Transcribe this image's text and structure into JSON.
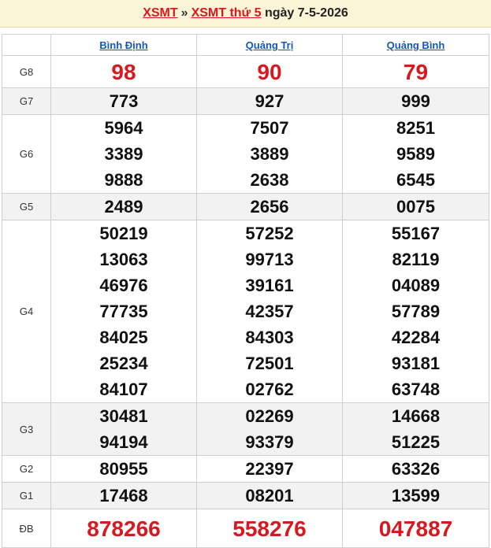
{
  "header": {
    "link1": "XSMT",
    "sep": "»",
    "link2": "XSMT thứ 5",
    "date_text": "ngày 7-5-2026"
  },
  "columns": [
    "Bình Định",
    "Quảng Trị",
    "Quảng Bình"
  ],
  "rows": [
    {
      "label": "G8",
      "values": [
        [
          "98"
        ],
        [
          "90"
        ],
        [
          "79"
        ]
      ]
    },
    {
      "label": "G7",
      "values": [
        [
          "773"
        ],
        [
          "927"
        ],
        [
          "999"
        ]
      ]
    },
    {
      "label": "G6",
      "values": [
        [
          "5964",
          "3389",
          "9888"
        ],
        [
          "7507",
          "3889",
          "2638"
        ],
        [
          "8251",
          "9589",
          "6545"
        ]
      ]
    },
    {
      "label": "G5",
      "values": [
        [
          "2489"
        ],
        [
          "2656"
        ],
        [
          "0075"
        ]
      ]
    },
    {
      "label": "G4",
      "values": [
        [
          "50219",
          "13063",
          "46976",
          "77735",
          "84025",
          "25234",
          "84107"
        ],
        [
          "57252",
          "99713",
          "39161",
          "42357",
          "84303",
          "72501",
          "02762"
        ],
        [
          "55167",
          "82119",
          "04089",
          "57789",
          "42284",
          "93181",
          "63748"
        ]
      ]
    },
    {
      "label": "G3",
      "values": [
        [
          "30481",
          "94194"
        ],
        [
          "02269",
          "93379"
        ],
        [
          "14668",
          "51225"
        ]
      ]
    },
    {
      "label": "G2",
      "values": [
        [
          "80955"
        ],
        [
          "22397"
        ],
        [
          "63326"
        ]
      ]
    },
    {
      "label": "G1",
      "values": [
        [
          "17468"
        ],
        [
          "08201"
        ],
        [
          "13599"
        ]
      ]
    },
    {
      "label": "ĐB",
      "values": [
        [
          "878266"
        ],
        [
          "558276"
        ],
        [
          "047887"
        ]
      ]
    }
  ]
}
